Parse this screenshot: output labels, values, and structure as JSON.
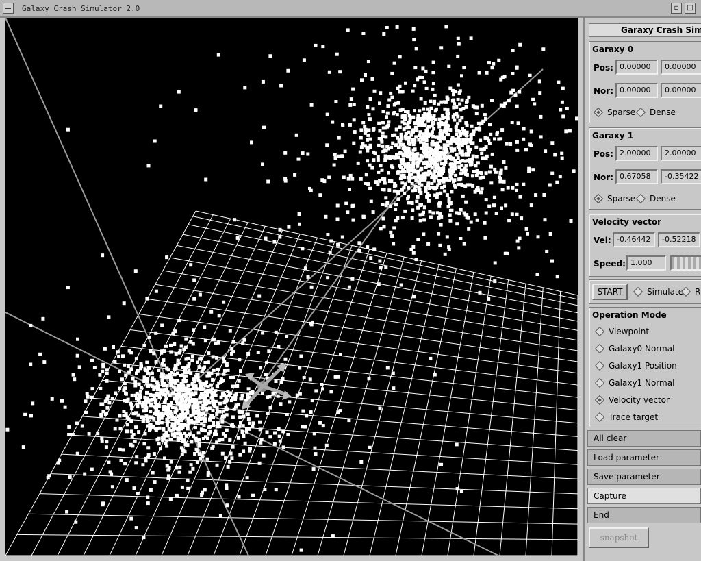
{
  "window": {
    "title": "Galaxy Crash Simulator 2.0"
  },
  "panel": {
    "title": "Garaxy Crash Simulator",
    "galaxy0": {
      "label": "Garaxy 0",
      "pos_label": "Pos:",
      "pos": [
        "0.00000",
        "0.00000"
      ],
      "nor_label": "Nor:",
      "nor": [
        "0.00000",
        "0.00000"
      ],
      "sparse_label": "Sparse",
      "dense_label": "Dense",
      "selected": "Sparse"
    },
    "galaxy1": {
      "label": "Garaxy 1",
      "pos_label": "Pos:",
      "pos": [
        "2.00000",
        "2.00000"
      ],
      "nor_label": "Nor:",
      "nor": [
        "0.67058",
        "-0.35422"
      ],
      "sparse_label": "Sparse",
      "dense_label": "Dense",
      "selected": "Sparse"
    },
    "velocity": {
      "label": "Velocity vector",
      "vel_label": "Vel:",
      "vel": [
        "-0.46442",
        "-0.52218"
      ],
      "speed_label": "Speed:",
      "speed": "1.000"
    },
    "control": {
      "start_label": "START",
      "simulate_label": "Simulate",
      "r_label": "R"
    },
    "operation_mode": {
      "label": "Operation Mode",
      "options": [
        "Viewpoint",
        "Galaxy0 Normal",
        "Galaxy1 Position",
        "Galaxy1 Normal",
        "Velocity vector",
        "Trace target"
      ],
      "selected": "Velocity vector"
    },
    "actions": {
      "all_clear": "All clear",
      "load": "Load parameter",
      "save": "Save parameter",
      "capture": "Capture",
      "end": "End"
    },
    "snapshot_label": "snapshot"
  },
  "colors": {
    "viewport_bg": "#000000",
    "panel_bg": "#c8c8c8",
    "grid": "#ffffff",
    "stars": "#ffffff",
    "axes": "#9a9a9a"
  },
  "icons": {
    "window_menu": "window-menu-icon",
    "radio": "diamond-radio-icon",
    "velocity_gizmo": "arrows-gizmo-icon"
  }
}
